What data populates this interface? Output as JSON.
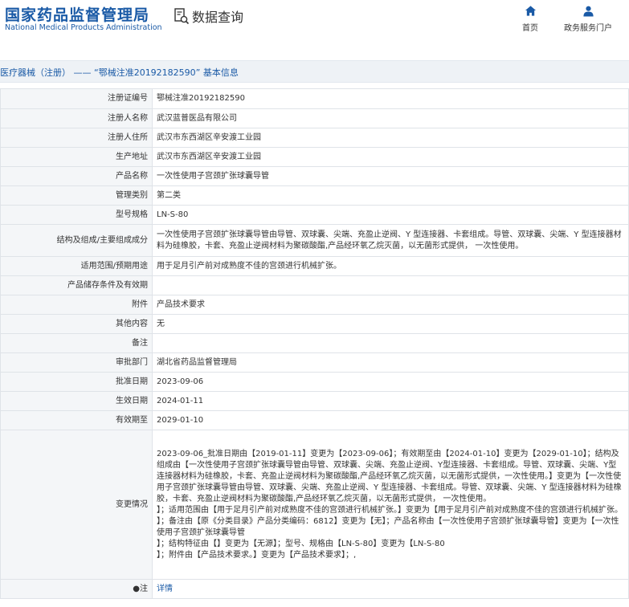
{
  "header": {
    "logo_cn": "国家药品监督管理局",
    "logo_en": "National Medical Products Administration",
    "query_label": "数据查询",
    "nav": [
      {
        "label": "首页",
        "icon": "home-icon"
      },
      {
        "label": "政务服务门户",
        "icon": "user-icon"
      }
    ]
  },
  "title": "医疗器械（注册） —— “鄂械注准20192182590” 基本信息",
  "rows": [
    {
      "label": "注册证编号",
      "value": "鄂械注准20192182590"
    },
    {
      "label": "注册人名称",
      "value": "武汉蓝普医品有限公司"
    },
    {
      "label": "注册人住所",
      "value": "武汉市东西湖区辛安渡工业园"
    },
    {
      "label": "生产地址",
      "value": "武汉市东西湖区辛安渡工业园"
    },
    {
      "label": "产品名称",
      "value": "一次性使用子宫颈扩张球囊导管"
    },
    {
      "label": "管理类别",
      "value": "第二类"
    },
    {
      "label": "型号规格",
      "value": "LN-S-80"
    },
    {
      "label": "结构及组成/主要组成成分",
      "value": "一次性使用子宫颈扩张球囊导管由导管、双球囊、尖端、充盈止逆阀、Y 型连接器、卡套组成。导管、双球囊、尖端、Y 型连接器材料为硅橡胶，卡套、充盈止逆阀材料为聚碳酸酯,产品经环氧乙烷灭菌，以无菌形式提供， 一次性使用。"
    },
    {
      "label": "适用范围/预期用途",
      "value": "用于足月引产前对成熟度不佳的宫颈进行机械扩张。"
    },
    {
      "label": "产品储存条件及有效期",
      "value": ""
    },
    {
      "label": "附件",
      "value": "产品技术要求"
    },
    {
      "label": "其他内容",
      "value": "无"
    },
    {
      "label": "备注",
      "value": ""
    },
    {
      "label": "审批部门",
      "value": "湖北省药品监督管理局"
    },
    {
      "label": "批准日期",
      "value": "2023-09-06"
    },
    {
      "label": "生效日期",
      "value": "2024-01-11"
    },
    {
      "label": "有效期至",
      "value": "2029-01-10"
    }
  ],
  "change": {
    "label": "变更情况",
    "lines": [
      "2023-09-06_批准日期由【2019-01-11】变更为【2023-09-06】；有效期至由【2024-01-10】变更为【2029-01-10】；结构及组成由【一次性使用子宫颈扩张球囊导管由导管、双球囊、尖端、充盈止逆阀、Y型连接器、卡套组成。导管、双球囊、尖端、Y型连接器材料为硅橡胶，卡套、充盈止逆阀材料为聚碳酸酯,产品经环氧乙烷灭菌，以无菌形式提供，一次性使用。】变更为【一次性使用子宫颈扩张球囊导管由导管、双球囊、尖端、充盈止逆阀、Y 型连接器、卡套组成。导管、双球囊、尖端、Y 型连接器材料为硅橡胶，卡套、充盈止逆阀材料为聚碳酸酯,产品经环氧乙烷灭菌，以无菌形式提供， 一次性使用。",
      "】；适用范围由【用于足月引产前对成熟度不佳的宫颈进行机械扩张。】变更为【用于足月引产前对成熟度不佳的宫颈进行机械扩张。",
      "】；备注由【原《分类目录》产品分类编码：6812】变更为【无】；产品名称由【一次性使用子宫颈扩张球囊导管】变更为【一次性使用子宫颈扩张球囊导管",
      "】；结构特征由【】变更为【无源】；型号、规格由【LN-S-80】变更为【LN-S-80",
      "】；附件由【产品技术要求。】变更为【产品技术要求】；,"
    ]
  },
  "note": {
    "label": "注",
    "link": "详情"
  }
}
